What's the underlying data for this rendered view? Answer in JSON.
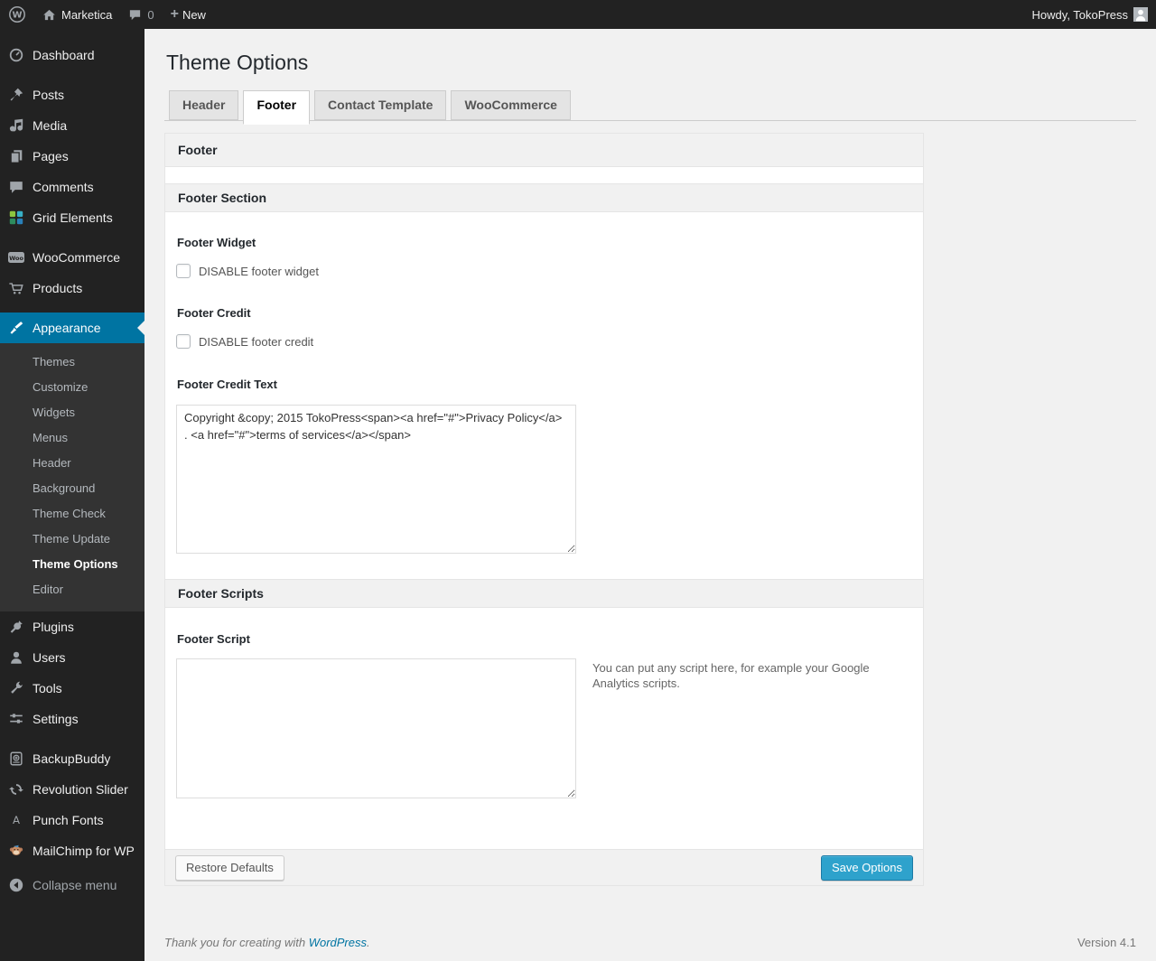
{
  "colors": {
    "accent": "#0074a2",
    "button_primary": "#2ea2cc",
    "admin_bar_bg": "#222222",
    "menu_bg": "#222222",
    "submenu_bg": "#333333",
    "page_bg": "#f1f1f1"
  },
  "admin_bar": {
    "site_name": "Marketica",
    "comment_count": "0",
    "new_label": "New",
    "howdy_text": "Howdy, TokoPress"
  },
  "sidebar": {
    "items": [
      {
        "label": "Dashboard",
        "icon": "dashboard-icon"
      },
      {
        "label": "Posts",
        "icon": "pin-icon"
      },
      {
        "label": "Media",
        "icon": "media-icon"
      },
      {
        "label": "Pages",
        "icon": "pages-icon"
      },
      {
        "label": "Comments",
        "icon": "comments-icon"
      },
      {
        "label": "Grid Elements",
        "icon": "grid-elements-icon"
      },
      {
        "label": "WooCommerce",
        "icon": "woocommerce-icon"
      },
      {
        "label": "Products",
        "icon": "cart-icon"
      },
      {
        "label": "Appearance",
        "icon": "appearance-icon",
        "active": true
      },
      {
        "label": "Plugins",
        "icon": "plugin-icon"
      },
      {
        "label": "Users",
        "icon": "users-icon"
      },
      {
        "label": "Tools",
        "icon": "tools-icon"
      },
      {
        "label": "Settings",
        "icon": "settings-icon"
      },
      {
        "label": "BackupBuddy",
        "icon": "backupbuddy-icon"
      },
      {
        "label": "Revolution Slider",
        "icon": "revolution-slider-icon"
      },
      {
        "label": "Punch Fonts",
        "icon": "punch-fonts-icon"
      },
      {
        "label": "MailChimp for WP",
        "icon": "mailchimp-icon"
      },
      {
        "label": "Collapse menu",
        "icon": "collapse-icon"
      }
    ],
    "appearance_submenu": [
      {
        "label": "Themes",
        "current": false
      },
      {
        "label": "Customize",
        "current": false
      },
      {
        "label": "Widgets",
        "current": false
      },
      {
        "label": "Menus",
        "current": false
      },
      {
        "label": "Header",
        "current": false
      },
      {
        "label": "Background",
        "current": false
      },
      {
        "label": "Theme Check",
        "current": false
      },
      {
        "label": "Theme Update",
        "current": false
      },
      {
        "label": "Theme Options",
        "current": true
      },
      {
        "label": "Editor",
        "current": false
      }
    ]
  },
  "main": {
    "title": "Theme Options",
    "tabs": [
      {
        "label": "Header",
        "active": false
      },
      {
        "label": "Footer",
        "active": true
      },
      {
        "label": "Contact Template",
        "active": false
      },
      {
        "label": "WooCommerce",
        "active": false
      }
    ],
    "panel_title": "Footer",
    "footer_section": {
      "title": "Footer Section",
      "widget_label": "Footer Widget",
      "widget_checkbox_label": "DISABLE footer widget",
      "widget_checkbox_checked": false,
      "credit_label": "Footer Credit",
      "credit_checkbox_label": "DISABLE footer credit",
      "credit_checkbox_checked": false,
      "credit_text_label": "Footer Credit Text",
      "credit_text_value": "Copyright &copy; 2015 TokoPress<span><a href=\"#\">Privacy Policy</a> . <a href=\"#\">terms of services</a></span>"
    },
    "footer_scripts": {
      "title": "Footer Scripts",
      "script_label": "Footer Script",
      "script_value": "",
      "helper_text": "You can put any script here, for example your Google Analytics scripts."
    },
    "actions": {
      "restore_label": "Restore Defaults",
      "save_label": "Save Options"
    }
  },
  "page_footer": {
    "thanks_prefix": "Thank you for creating with ",
    "wordpress_link_label": "WordPress",
    "thanks_suffix": ".",
    "version_text": "Version 4.1"
  }
}
